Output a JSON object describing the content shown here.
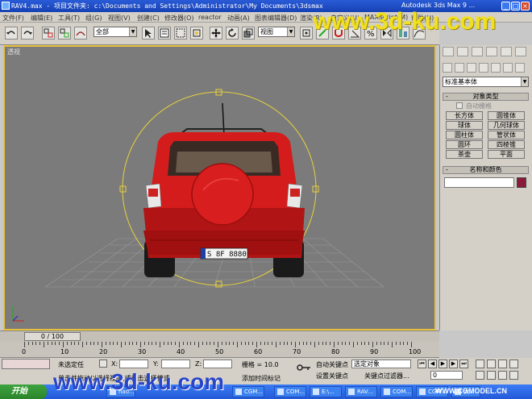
{
  "window": {
    "title": "RAV4.max  - 项目文件夹: c:\\Documents and Settings\\Administrator\\My Documents\\3dsmax",
    "app": "Autodesk 3ds Max 9 ..."
  },
  "menu": [
    "文件(F)",
    "编辑(E)",
    "工具(T)",
    "组(G)",
    "视图(V)",
    "创建(C)",
    "修改器(O)",
    "reactor",
    "动画(A)",
    "图表编辑器(D)",
    "渲染(R)",
    "自定义(U)",
    "MAXScript(M)",
    "帮助(H)"
  ],
  "toolbar": {
    "selection_filter": "全部",
    "ref_coord": "视图"
  },
  "viewport": {
    "label": "透视",
    "plate": "S 8F 8880"
  },
  "command_panel": {
    "category": "标准基本体",
    "object_type_header": "对象类型",
    "autogrid": "自动栅格",
    "objects": [
      "长方体",
      "圆锥体",
      "球体",
      "几何球体",
      "圆柱体",
      "管状体",
      "圆环",
      "四棱锥",
      "茶壶",
      "平面"
    ],
    "name_color_header": "名称和颜色",
    "object_color": "#8b1a3a"
  },
  "timeline": {
    "slider_label": "0 / 100",
    "ticks": [
      "0",
      "10",
      "20",
      "30",
      "40",
      "50",
      "60",
      "70",
      "80",
      "90",
      "100"
    ]
  },
  "status": {
    "selection": "未选定任",
    "x_label": "X:",
    "y_label": "Y:",
    "z_label": "Z:",
    "grid": "栅格 = 10.0",
    "auto_key": "自动关键点",
    "set_key": "设置关键点",
    "selected_object": "选定对象",
    "key_filters": "关键点过滤器...",
    "frame": "0",
    "prompt": "单击并拖动以选择视图,或单击选择模式",
    "add_time_tag": "添加时间标记"
  },
  "taskbar": {
    "start": "开始",
    "tasks": [
      "hao...",
      "CGM...",
      "COM...",
      "E:\\...",
      "RAV...",
      "COM...",
      "CGM...",
      "大..."
    ]
  },
  "watermarks": {
    "top": "www.3d-ku.com",
    "bottom": "www.3d-ku.com",
    "corner": "WWW.CGMODEL.CN"
  }
}
